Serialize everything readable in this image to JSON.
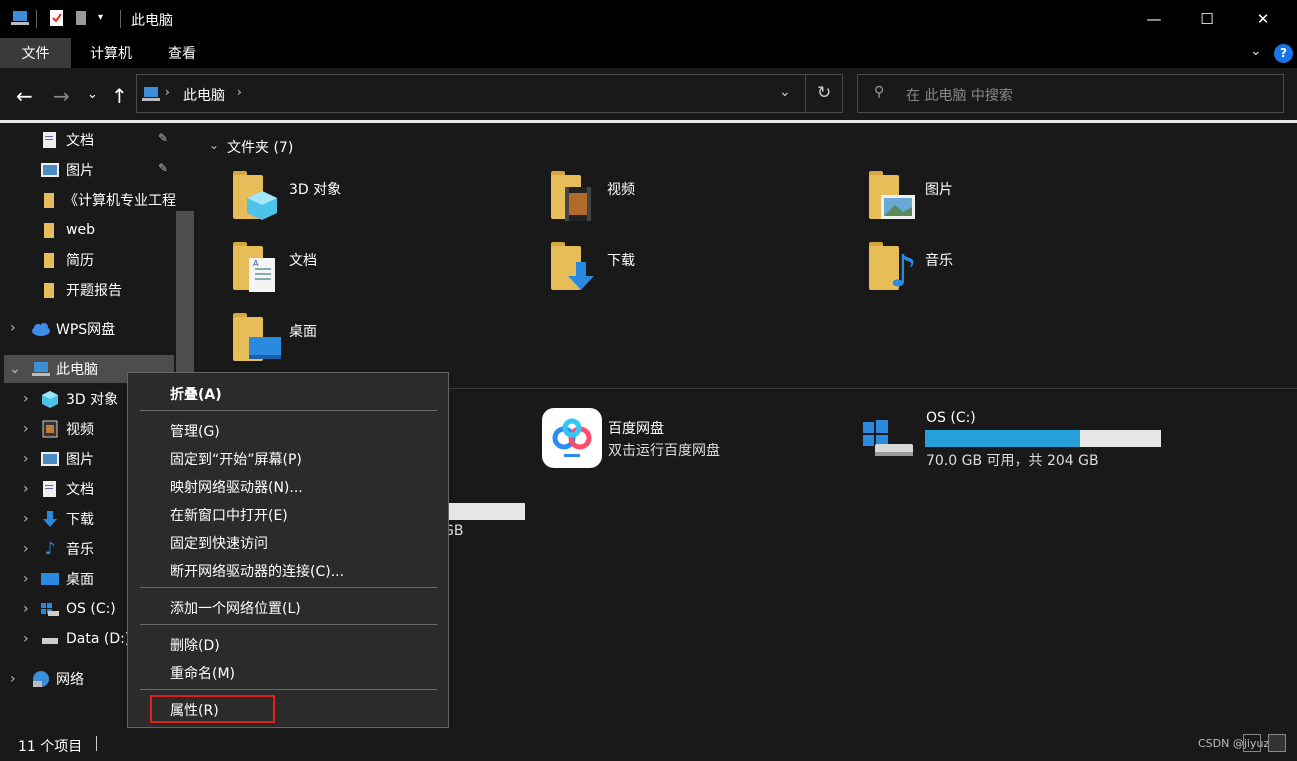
{
  "window": {
    "title": "此电脑",
    "minimize": "—",
    "maximize": "☐",
    "close": "✕"
  },
  "ribbon": {
    "tabs": [
      "文件",
      "计算机",
      "查看"
    ]
  },
  "address": {
    "crumb": "此电脑",
    "search_placeholder": "在 此电脑 中搜索"
  },
  "sidebar": {
    "quick": [
      {
        "label": "文档",
        "pinned": true
      },
      {
        "label": "图片",
        "pinned": true
      },
      {
        "label": "《计算机专业工程"
      },
      {
        "label": "web"
      },
      {
        "label": "简历"
      },
      {
        "label": "开题报告"
      }
    ],
    "wps": "WPS网盘",
    "thispc": "此电脑",
    "pc_children": [
      "3D 对象",
      "视频",
      "图片",
      "文档",
      "下载",
      "音乐",
      "桌面",
      "OS (C:)",
      "Data (D:)"
    ],
    "network": "网络"
  },
  "main": {
    "folders_header": "文件夹 (7)",
    "folders": [
      "3D 对象",
      "视频",
      "图片",
      "文档",
      "下载",
      "音乐",
      "桌面"
    ],
    "baidu": {
      "name": "百度网盘",
      "sub": "双击运行百度网盘"
    },
    "osc": {
      "name": "OS (C:)",
      "free": "70.0 GB 可用，共 204 GB",
      "used_fraction": 0.657
    },
    "partial_d_text": "GB"
  },
  "context_menu": {
    "items": [
      {
        "label": "折叠(A)",
        "bold": true
      },
      {
        "label": "管理(G)"
      },
      {
        "label": "固定到“开始”屏幕(P)"
      },
      {
        "label": "映射网络驱动器(N)..."
      },
      {
        "label": "在新窗口中打开(E)"
      },
      {
        "label": "固定到快速访问"
      },
      {
        "label": "断开网络驱动器的连接(C)..."
      },
      {
        "label": "添加一个网络位置(L)"
      },
      {
        "label": "删除(D)"
      },
      {
        "label": "重命名(M)"
      },
      {
        "label": "属性(R)"
      }
    ]
  },
  "status": {
    "count": "11 个项目",
    "watermark": "CSDN @jiyuzzz"
  },
  "colors": {
    "accent": "#26a0da",
    "highlight_box": "#e0201c",
    "folder": "#e7bd59"
  }
}
